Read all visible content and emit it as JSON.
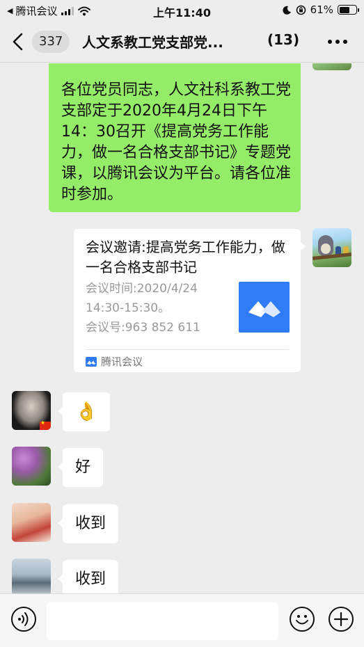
{
  "status_bar": {
    "back_app": "腾讯会议",
    "time": "上午11:40",
    "battery": "61%",
    "battery_level": 0.61
  },
  "nav": {
    "unread_count": "337",
    "title": "人文系教工党支部党...",
    "member_count": "(13)"
  },
  "messages": {
    "announcement": "各位党员同志，人文社科系教工党支部定于2020年4月24日下午14：30召开《提高党务工作能力，做一名合格支部书记》专题党课，以腾讯会议为平台。请各位准时参加。",
    "card": {
      "title": "会议邀请:提高党务工作能力，做一名合格支部书记",
      "time_line": "会议时间:2020/4/24",
      "time_range": "14:30-15:30。",
      "meeting_id": "会议号:963 852 611",
      "source": "腾讯会议"
    },
    "reply_1": "👌",
    "reply_2": "好",
    "reply_3": "收到",
    "reply_4": "收到"
  },
  "input": {
    "placeholder": ""
  },
  "icons": {
    "back": "chevron-left-icon",
    "more": "more-dots-icon",
    "voice": "voice-icon",
    "emoji": "emoji-icon",
    "plus": "plus-icon",
    "meeting_logo": "tencent-meeting-logo-icon"
  },
  "colors": {
    "sent_bubble": "#95ec69",
    "background": "#ededed",
    "meeting_blue": "#2f7cf6"
  }
}
